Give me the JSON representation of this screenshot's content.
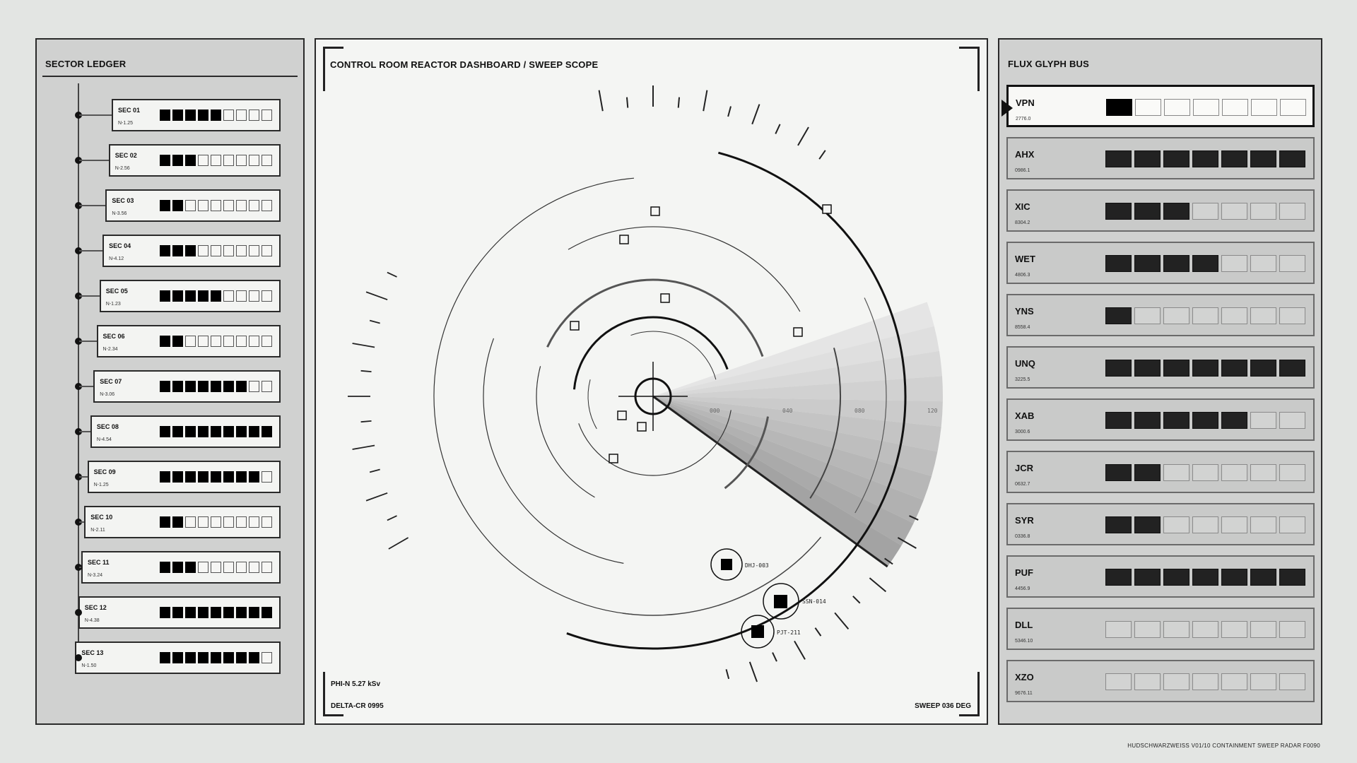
{
  "ledger": {
    "title": "SECTOR LEDGER",
    "rows": [
      {
        "label": "SEC 01",
        "sub": "N-1.25",
        "filled": 5,
        "total": 9
      },
      {
        "label": "SEC 02",
        "sub": "N-2.56",
        "filled": 3,
        "total": 9
      },
      {
        "label": "SEC 03",
        "sub": "N-3.56",
        "filled": 2,
        "total": 9
      },
      {
        "label": "SEC 04",
        "sub": "N-4.12",
        "filled": 3,
        "total": 9
      },
      {
        "label": "SEC 05",
        "sub": "N-1.23",
        "filled": 5,
        "total": 9
      },
      {
        "label": "SEC 06",
        "sub": "N-2.34",
        "filled": 2,
        "total": 9
      },
      {
        "label": "SEC 07",
        "sub": "N-3.06",
        "filled": 7,
        "total": 9
      },
      {
        "label": "SEC 08",
        "sub": "N-4.54",
        "filled": 9,
        "total": 9
      },
      {
        "label": "SEC 09",
        "sub": "N-1.25",
        "filled": 8,
        "total": 9
      },
      {
        "label": "SEC 10",
        "sub": "N-2.11",
        "filled": 2,
        "total": 9
      },
      {
        "label": "SEC 11",
        "sub": "N-3.24",
        "filled": 3,
        "total": 9
      },
      {
        "label": "SEC 12",
        "sub": "N-4.38",
        "filled": 9,
        "total": 9
      },
      {
        "label": "SEC 13",
        "sub": "N-1.50",
        "filled": 8,
        "total": 9
      }
    ]
  },
  "scope": {
    "title": "CONTROL ROOM REACTOR DASHBOARD  /  SWEEP SCOPE",
    "range_labels": [
      "000",
      "040",
      "080",
      "120"
    ],
    "contacts": [
      {
        "id": "DHJ-003"
      },
      {
        "id": "SSN-014"
      },
      {
        "id": "PJT-211"
      }
    ],
    "readout_phi": "PHI-N  5.27 kSv",
    "readout_delta": "DELTA-CR 0995",
    "readout_sweep": "SWEEP 036 DEG"
  },
  "bus": {
    "title": "FLUX GLYPH BUS",
    "rows": [
      {
        "label": "VPN",
        "sub": "2776.0",
        "filled": 1,
        "total": 7,
        "active": true
      },
      {
        "label": "AHX",
        "sub": "0986.1",
        "filled": 7,
        "total": 7
      },
      {
        "label": "XIC",
        "sub": "8304.2",
        "filled": 3,
        "total": 7
      },
      {
        "label": "WET",
        "sub": "4806.3",
        "filled": 4,
        "total": 7
      },
      {
        "label": "YNS",
        "sub": "8558.4",
        "filled": 1,
        "total": 7
      },
      {
        "label": "UNQ",
        "sub": "3225.5",
        "filled": 7,
        "total": 7
      },
      {
        "label": "XAB",
        "sub": "3000.6",
        "filled": 5,
        "total": 7
      },
      {
        "label": "JCR",
        "sub": "0632.7",
        "filled": 2,
        "total": 7
      },
      {
        "label": "SYR",
        "sub": "0336.8",
        "filled": 2,
        "total": 7
      },
      {
        "label": "PUF",
        "sub": "4456.9",
        "filled": 7,
        "total": 7
      },
      {
        "label": "DLL",
        "sub": "5346.10",
        "filled": 0,
        "total": 7
      },
      {
        "label": "XZO",
        "sub": "9676.11",
        "filled": 0,
        "total": 7
      }
    ]
  },
  "footer": "HUDSCHWARZWEISS  V01/10  CONTAINMENT SWEEP RADAR  F0090"
}
